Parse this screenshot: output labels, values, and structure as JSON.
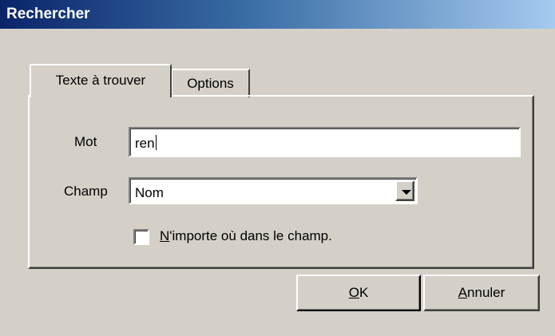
{
  "window": {
    "title": "Rechercher"
  },
  "tabs": [
    {
      "label": "Texte à trouver",
      "active": true
    },
    {
      "label": "Options",
      "active": false
    }
  ],
  "form": {
    "mot": {
      "label": "Mot",
      "value": "ren"
    },
    "champ": {
      "label": "Champ",
      "selected": "Nom"
    },
    "checkbox": {
      "accel": "N",
      "label_rest": "'importe où dans le champ.",
      "checked": false
    }
  },
  "buttons": {
    "ok": {
      "accel": "O",
      "rest": "K"
    },
    "cancel": {
      "accel": "A",
      "rest": "nnuler"
    }
  },
  "icons": {
    "dropdown": "chevron-down-icon"
  }
}
